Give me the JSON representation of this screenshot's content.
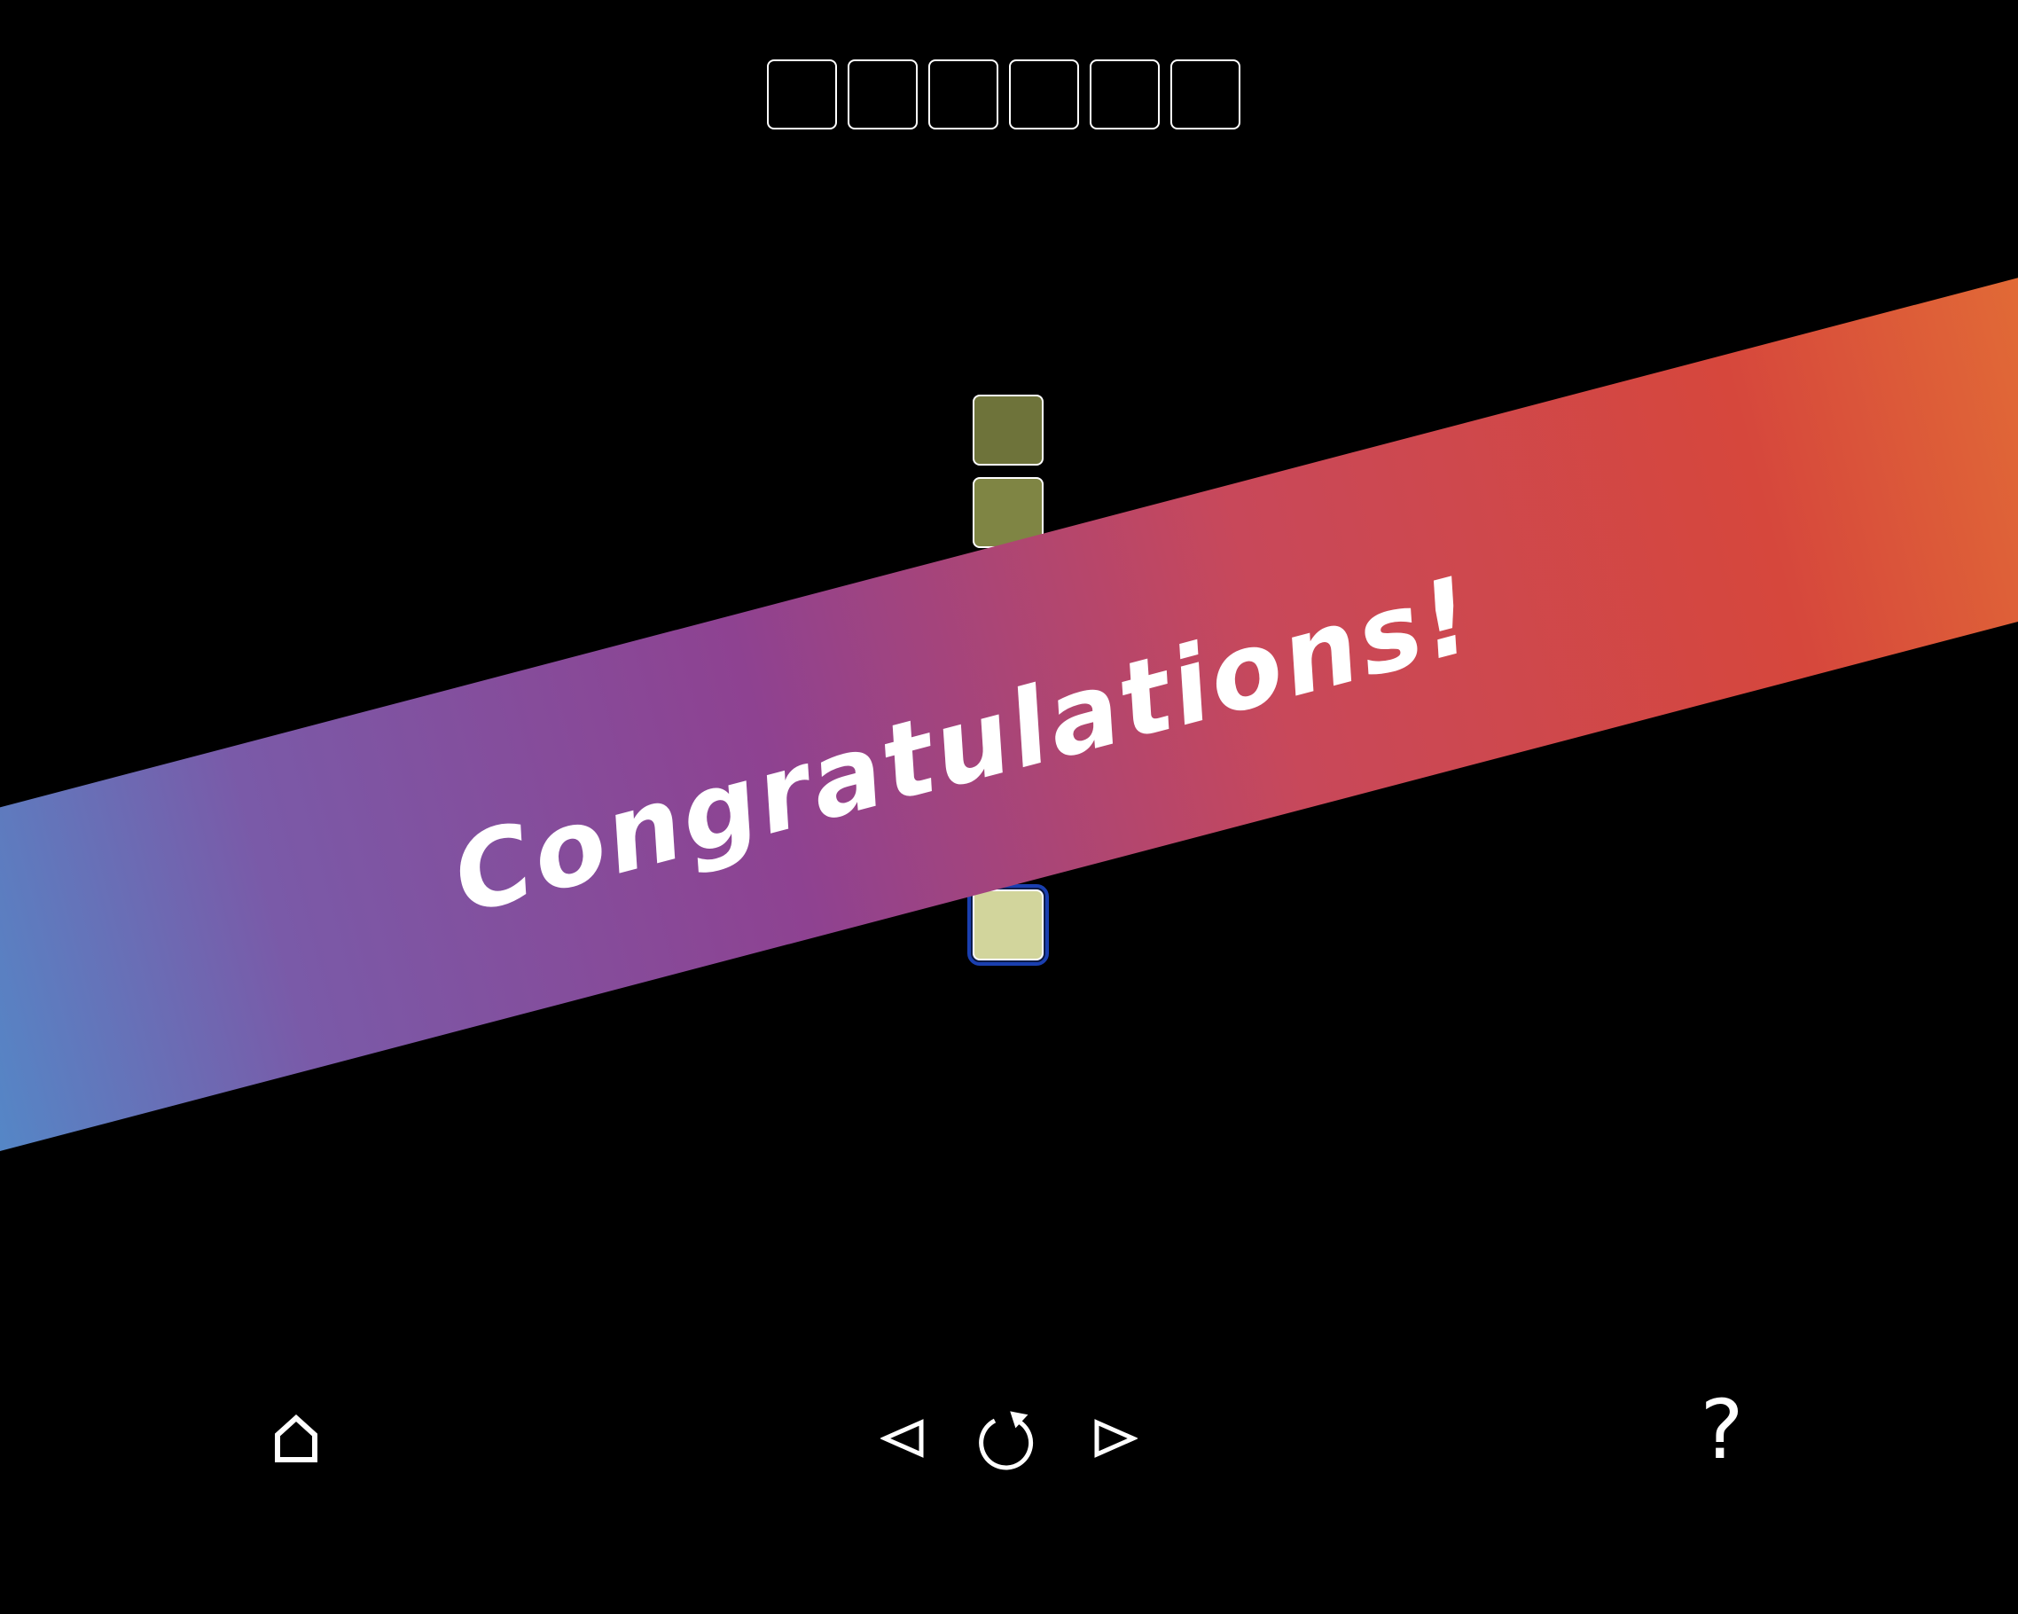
{
  "progress": {
    "slot_count": 6
  },
  "tiles": [
    {
      "color": "#6e733a",
      "row": 0
    },
    {
      "color": "#7f8544",
      "row": 1
    },
    {
      "color": "#c5c985",
      "row": 5
    },
    {
      "color": "#d2d59c",
      "row": 6,
      "selected": true
    }
  ],
  "banner": {
    "text": "Congratulations!",
    "gradient": [
      "#3fa0d8",
      "#7a5aa8",
      "#8e4291",
      "#c8485a",
      "#d6473c",
      "#e98232"
    ]
  },
  "controls": {
    "home_icon": "home-icon",
    "prev_icon": "triangle-left-icon",
    "restart_icon": "restart-icon",
    "next_icon": "triangle-right-icon",
    "help_label": "?"
  }
}
